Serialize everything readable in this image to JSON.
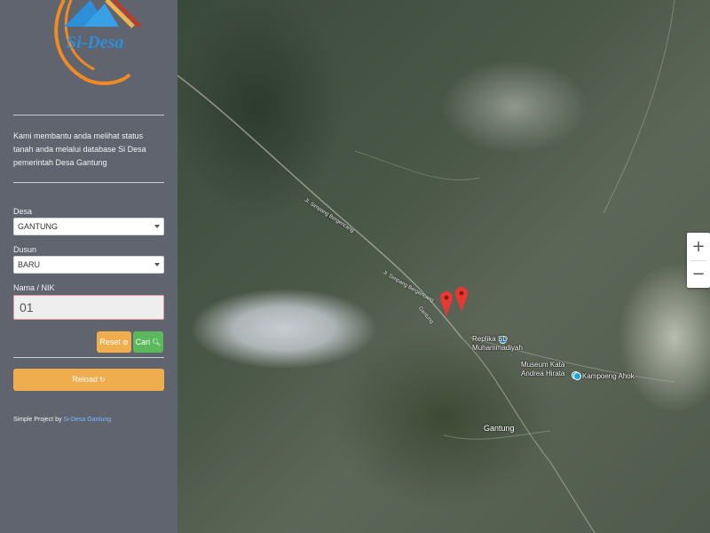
{
  "sidebar": {
    "logo_text": "Si-Desa",
    "intro": "Kami membantu anda melihat status tanah anda melalui database Si Desa pemerintah Desa Gantung",
    "desa": {
      "label": "Desa",
      "value": "GANTUNG"
    },
    "dusun": {
      "label": "Dusun",
      "value": "BARU"
    },
    "nik": {
      "label": "Nama / NIK",
      "value": "01"
    },
    "buttons": {
      "reset": "Reset",
      "cari": "Cari",
      "reload": "Reload"
    },
    "footer": {
      "prefix": "Simple Project by",
      "link": "Si-Desa Gantung"
    }
  },
  "map": {
    "zoom_in": "+",
    "zoom_out": "−",
    "markers_count": 2,
    "pois": [
      {
        "label": "Replika SD Muhammadiyah"
      },
      {
        "label": "Museum Kata Andrea Hirata"
      },
      {
        "label": "Kampoeng Ahok"
      }
    ],
    "town": "Gantung",
    "roads": [
      "Jl. Simpang Bergencang",
      "Gantung",
      "Jl. Simpang Bergencang"
    ]
  },
  "colors": {
    "sidebar_bg": "#5f646e",
    "reset_btn": "#f0ad4e",
    "cari_btn": "#5cb85c",
    "reload_btn": "#f0ad4e",
    "marker": "#e53935",
    "poi": "#21a5d8"
  },
  "icons": {
    "reset": "ban-icon",
    "cari": "search-icon",
    "reload": "refresh-icon",
    "marker": "map-pin-icon"
  }
}
